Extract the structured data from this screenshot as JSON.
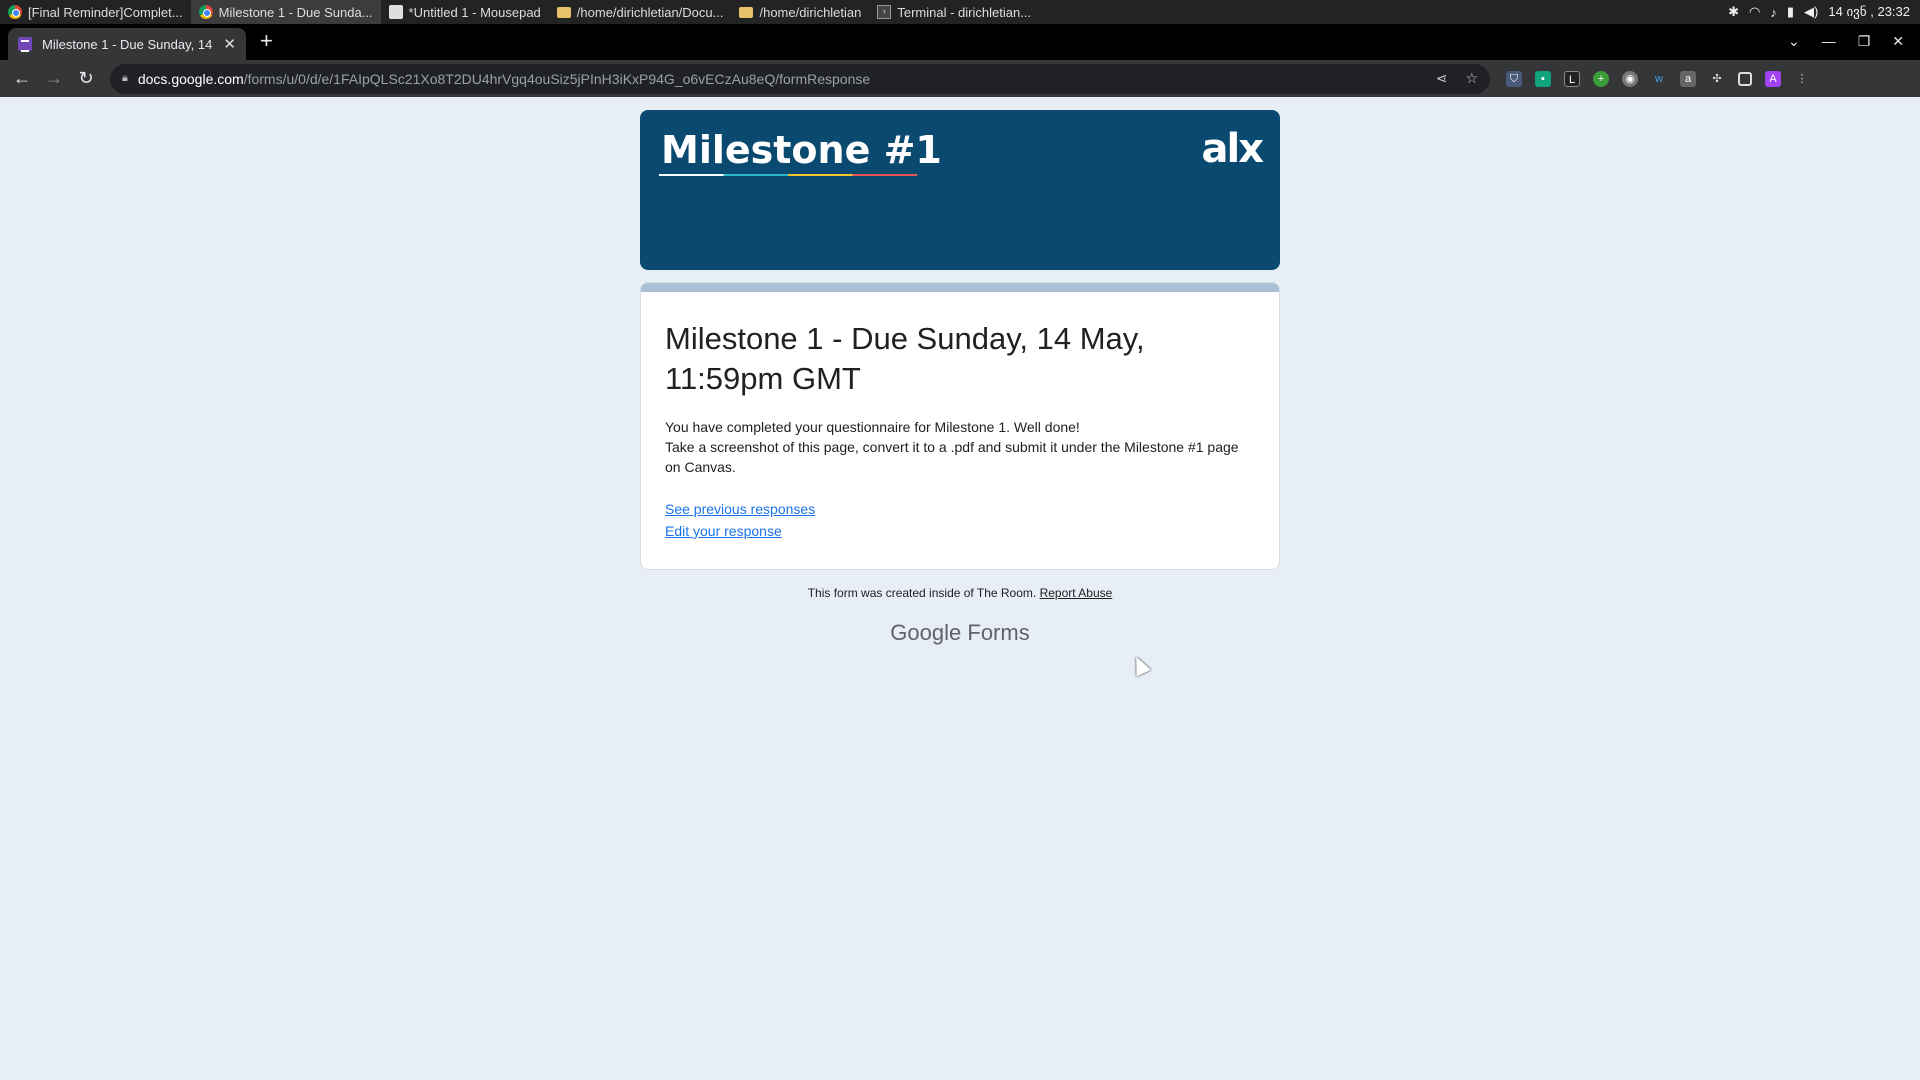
{
  "taskbar": {
    "items": [
      {
        "label": "[Final Reminder]Complet...",
        "icon": "chrome-icon"
      },
      {
        "label": "Milestone 1 - Due Sunda...",
        "icon": "chrome-icon"
      },
      {
        "label": "*Untitled 1 - Mousepad",
        "icon": "mousepad-icon"
      },
      {
        "label": "/home/dirichletian/Docu...",
        "icon": "folder-icon"
      },
      {
        "label": "/home/dirichletian",
        "icon": "folder-icon"
      },
      {
        "label": "Terminal - dirichletian...",
        "icon": "terminal-icon"
      }
    ],
    "clock": "14 ივნ , 23:32"
  },
  "browser": {
    "tab_title": "Milestone 1 - Due Sunday, 14",
    "url_host": "docs.google.com",
    "url_path": "/forms/u/0/d/e/1FAIpQLSc21Xo8T2DU4hrVgq4ouSiz5jPInH3iKxP94G_o6vECzAu8eQ/formResponse",
    "avatar_letter": "A"
  },
  "form": {
    "banner_title": "Milestone #1",
    "banner_logo": "alx",
    "title": "Milestone 1 - Due Sunday, 14 May, 11:59pm GMT",
    "message": "You have completed your questionnaire for Milestone 1. Well done!\nTake a screenshot of this page, convert it to a .pdf and submit it under the Milestone #1 page on Canvas.",
    "link_previous": "See previous responses",
    "link_edit": "Edit your response",
    "footer_note": "This form was created inside of The Room.",
    "report_abuse": "Report Abuse",
    "brand_google": "Google",
    "brand_forms": "Forms"
  },
  "colors": {
    "banner": "#0b4a70",
    "page_bg": "#e8eef6",
    "link": "#1a73e8"
  }
}
